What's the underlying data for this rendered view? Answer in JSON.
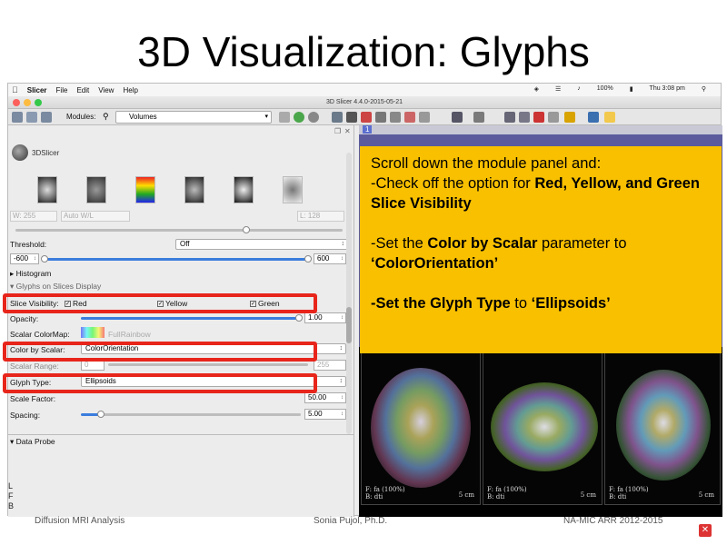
{
  "slide": {
    "title": "3D Visualization: Glyphs",
    "footer_left": "Diffusion MRI Analysis",
    "footer_center": "Sonia Pujol, Ph.D.",
    "footer_right": "NA-MIC ARR 2012-2015"
  },
  "menubar": {
    "apple": "",
    "items": [
      "Slicer",
      "File",
      "Edit",
      "View",
      "Help"
    ],
    "battery": "100%",
    "clock": "Thu 3:08 pm"
  },
  "window": {
    "title": "3D Slicer 4.4.0-2015-05-21"
  },
  "toolbar": {
    "modules_label": "Modules:",
    "module_value": "Volumes"
  },
  "panel": {
    "logo_text": "3DSlicer",
    "window_value": "W: 255",
    "auto_wl": "Auto W/L",
    "level_value": "L: 128",
    "threshold_label": "Threshold:",
    "threshold_value": "Off",
    "range_min": "-600",
    "range_max": "600",
    "histogram_label": "Histogram",
    "glyphs_section": "Glyphs on Slices Display",
    "slice_visibility_label": "Slice Visibility:",
    "vis_red": "Red",
    "vis_yellow": "Yellow",
    "vis_green": "Green",
    "opacity_label": "Opacity:",
    "opacity_value": "1.00",
    "opacity_fraction": 1.0,
    "colormap_label": "Scalar ColorMap:",
    "colormap_value": "FullRainbow",
    "color_by_scalar_label": "Color by Scalar:",
    "color_by_scalar_value": "ColorOrientation",
    "scalar_range_label": "Scalar Range:",
    "scalar_range_min": "0",
    "scalar_range_max": "255",
    "glyph_type_label": "Glyph Type:",
    "glyph_type_value": "Ellipsoids",
    "scale_factor_label": "Scale Factor:",
    "scale_factor_value": "50.00",
    "spacing_label": "Spacing:",
    "spacing_value": "5.00",
    "data_probe_label": "Data Probe",
    "orientation": "L\nF\nB"
  },
  "callout": {
    "line1": "Scroll down the module panel and:",
    "line2a": "-Check off the option for ",
    "line2b": "Red, Yellow, and Green Slice Visibility",
    "line3a": "-Set the ",
    "line3b": "Color by Scalar",
    "line3c": " parameter to ",
    "line3d": "‘ColorOrientation’",
    "line4a": "-Set the ",
    "line4b": "Glyph Type",
    "line4c": " to ",
    "line4d": "‘Ellipsoids’"
  },
  "viewers": {
    "label_f": "F: fa (100%)",
    "label_b": "B: dti",
    "scale": "5 cm"
  },
  "colors": {
    "highlight": "#e8251b",
    "callout": "#f9c000",
    "red_slice": "#c0392b",
    "yellow_slice": "#e6c41e",
    "green_slice": "#3d9a3d"
  }
}
